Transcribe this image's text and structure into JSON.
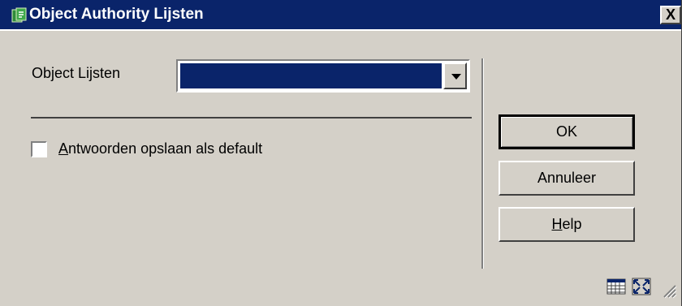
{
  "window": {
    "title": "Object Authority Lijsten",
    "close_label": "X"
  },
  "form": {
    "object_lijsten_label": "Object Lijsten",
    "object_lijsten_value": "",
    "checkbox_label_first": "A",
    "checkbox_label_rest": "ntwoorden opslaan als default",
    "checkbox_checked": false
  },
  "buttons": {
    "ok": "OK",
    "annuleer": "Annuleer",
    "help_first": "H",
    "help_rest": "elp"
  },
  "icons": {
    "app": "app-icon",
    "grid": "grid-icon",
    "expand": "expand-icon",
    "resize": "resize-grip-icon"
  }
}
